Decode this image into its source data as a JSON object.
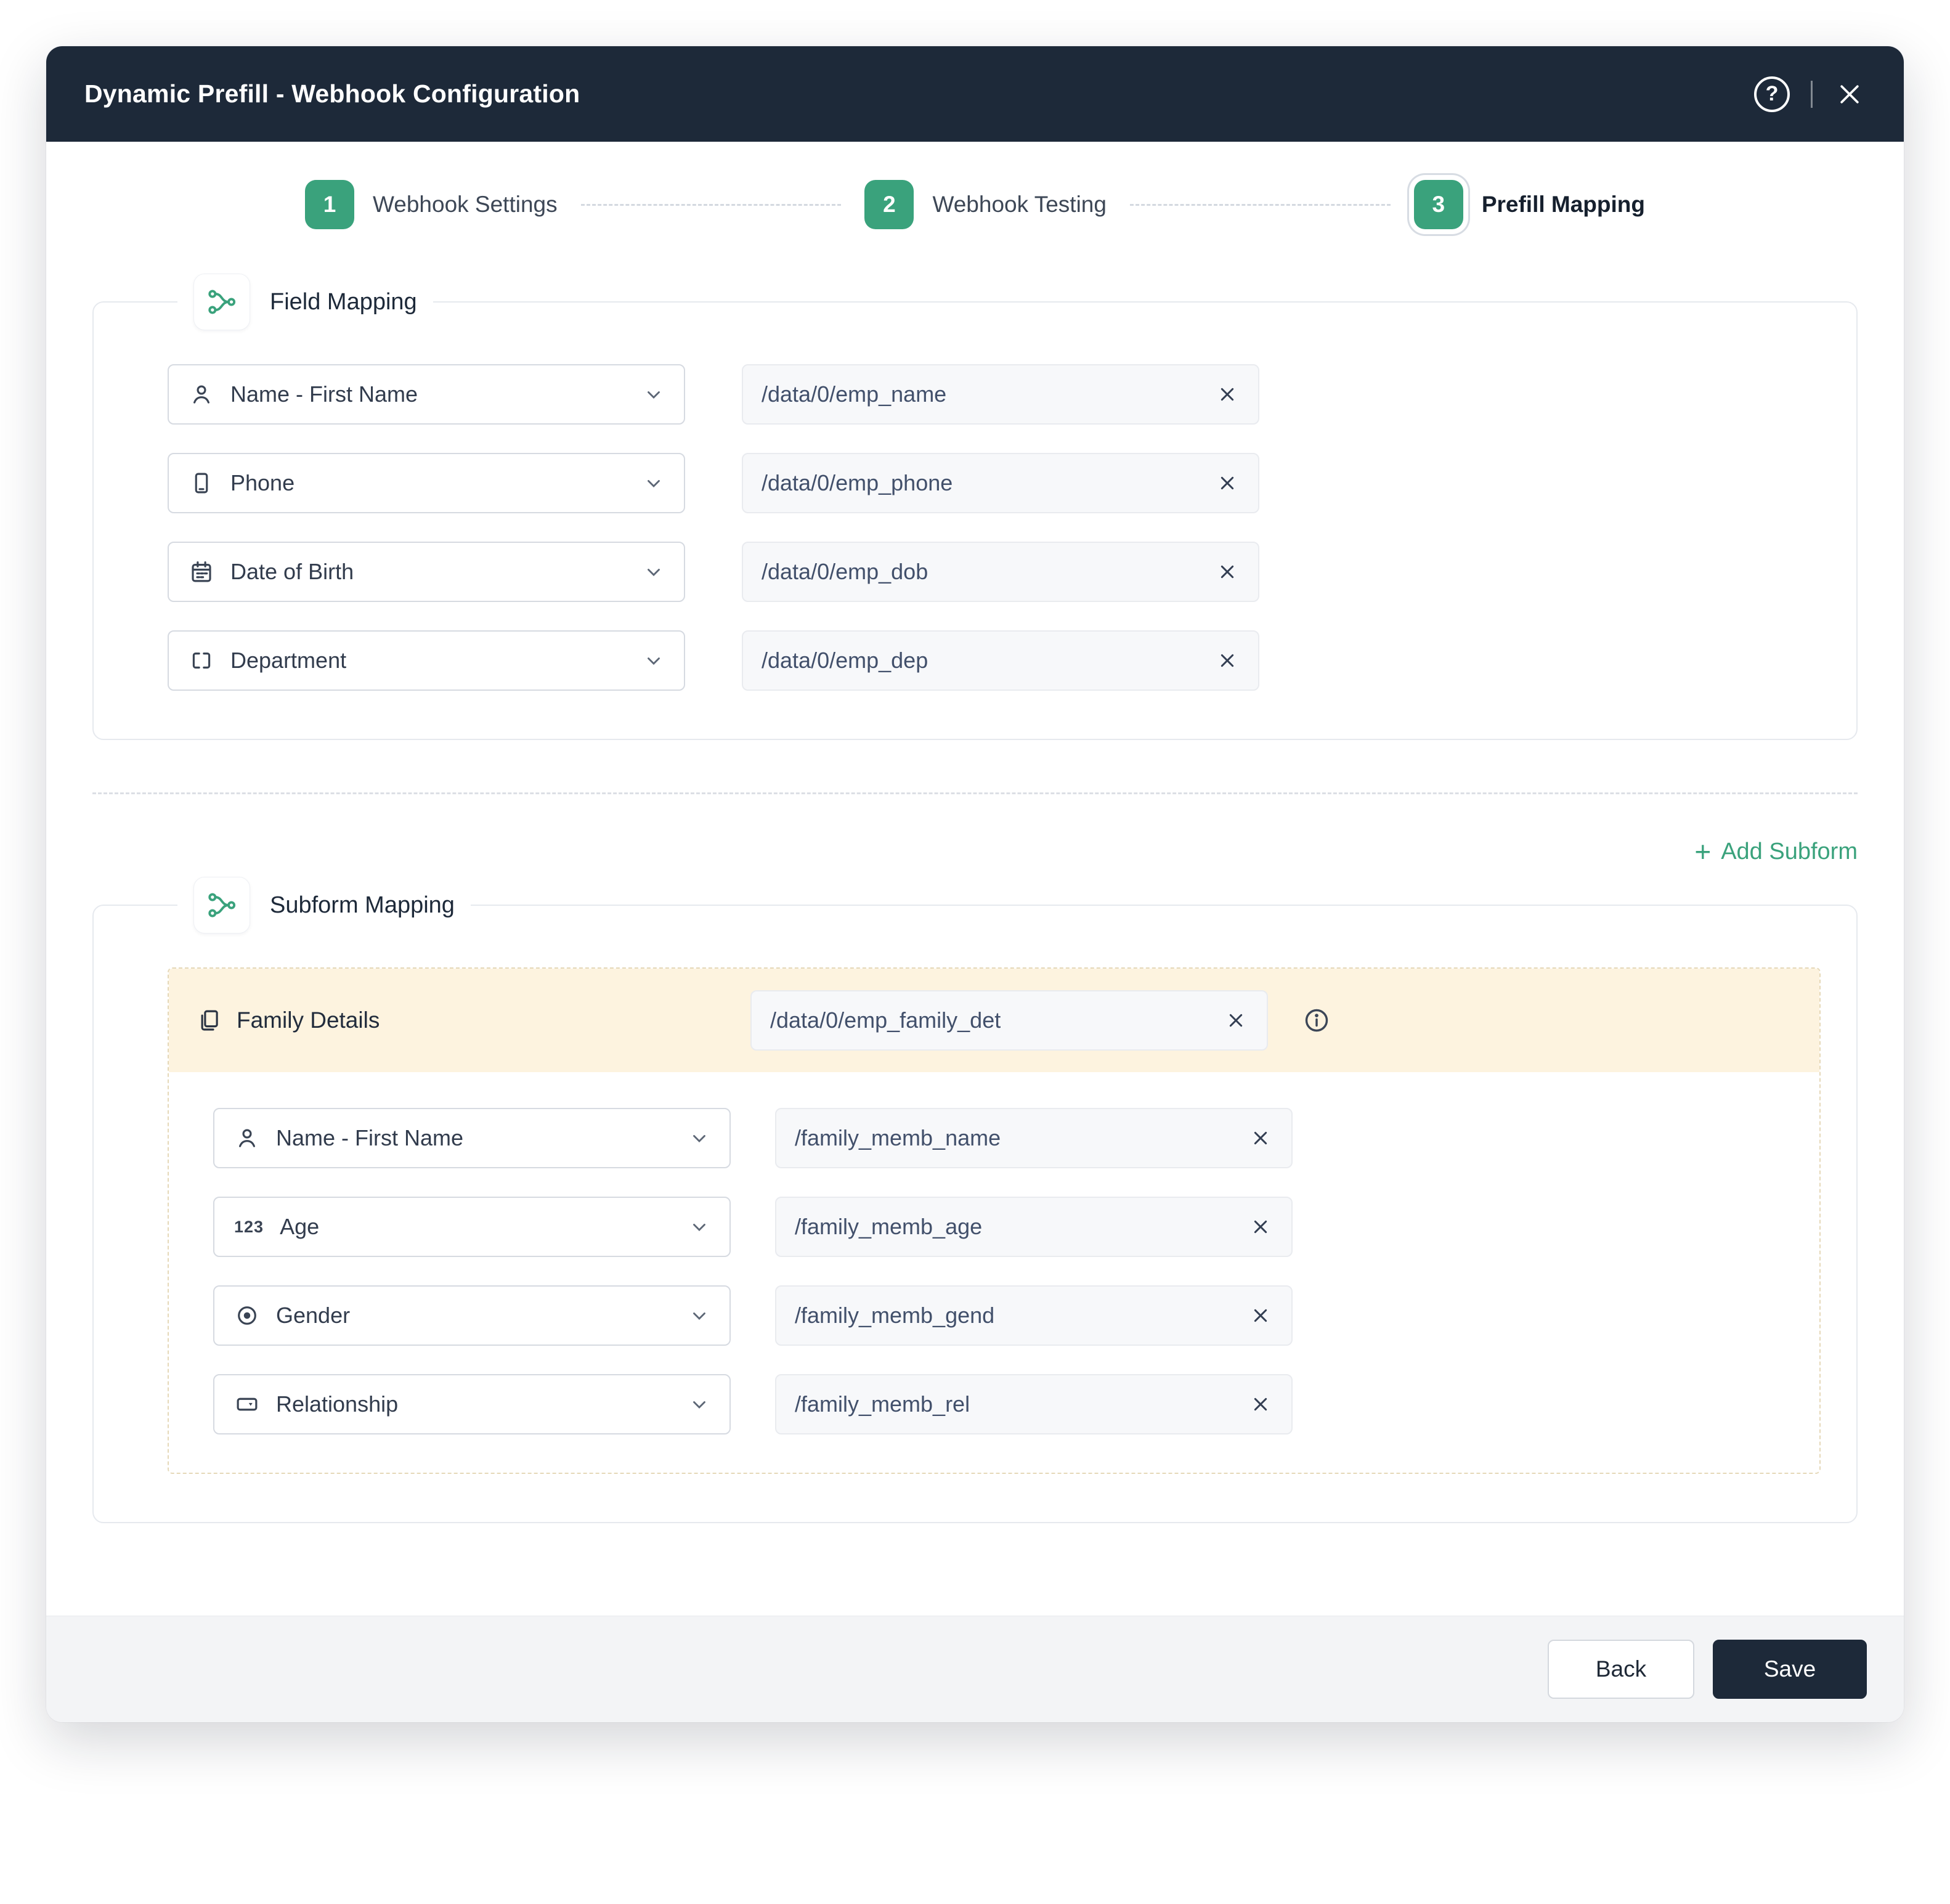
{
  "modal": {
    "title": "Dynamic Prefill - Webhook Configuration"
  },
  "stepper": {
    "steps": [
      {
        "number": "1",
        "label": "Webhook Settings",
        "active": false
      },
      {
        "number": "2",
        "label": "Webhook Testing",
        "active": false
      },
      {
        "number": "3",
        "label": "Prefill Mapping",
        "active": true
      }
    ]
  },
  "field_mapping": {
    "legend": "Field Mapping",
    "rows": [
      {
        "icon": "user-icon",
        "field": "Name - First Name",
        "value": "/data/0/emp_name"
      },
      {
        "icon": "phone-icon",
        "field": "Phone",
        "value": "/data/0/emp_phone"
      },
      {
        "icon": "calendar-icon",
        "field": "Date of Birth",
        "value": "/data/0/emp_dob"
      },
      {
        "icon": "department-icon",
        "field": "Department",
        "value": "/data/0/emp_dep"
      }
    ]
  },
  "subform_mapping": {
    "legend": "Subform Mapping",
    "add_button_label": "Add Subform",
    "header": {
      "icon": "pages-icon",
      "label": "Family Details",
      "value": "/data/0/emp_family_det"
    },
    "rows": [
      {
        "icon": "user-icon",
        "field": "Name - First Name",
        "value": "/family_memb_name"
      },
      {
        "icon": "number-123-icon",
        "field": "Age",
        "value": "/family_memb_age"
      },
      {
        "icon": "radio-icon",
        "field": "Gender",
        "value": "/family_memb_gend"
      },
      {
        "icon": "dropdown-field-icon",
        "field": "Relationship",
        "value": "/family_memb_rel"
      }
    ]
  },
  "footer": {
    "back_label": "Back",
    "save_label": "Save"
  },
  "colors": {
    "header_navy": "#1d2939",
    "accent_green": "#3aa27c",
    "subform_highlight": "#fdf3df",
    "input_background": "#f7f8fa"
  }
}
